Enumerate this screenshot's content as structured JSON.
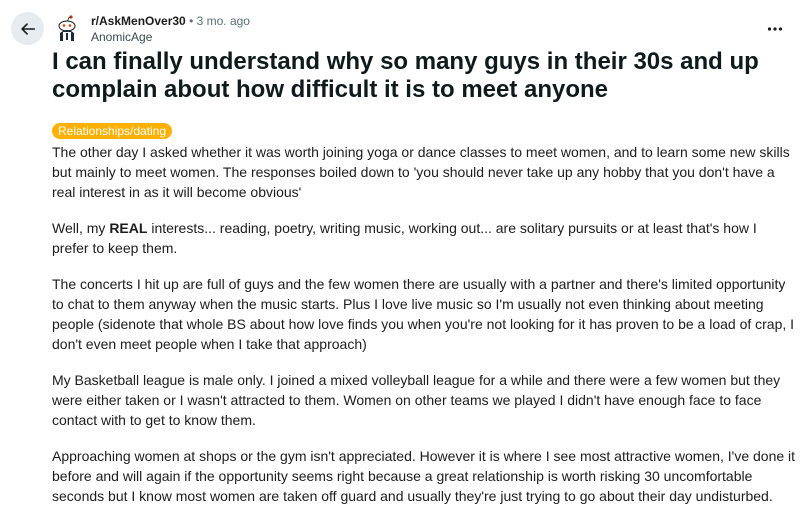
{
  "header": {
    "subreddit": "r/AskMenOver30",
    "separator": "•",
    "age": "3 mo. ago",
    "author": "AnomicAge",
    "icons": {
      "back": "arrow-left-icon",
      "more": "more-horizontal-icon",
      "avatar": "snoo-avatar-icon"
    }
  },
  "post": {
    "title": "I can finally understand why so many guys in their 30s and up complain about how difficult it is to meet anyone",
    "flair": "Relationships/dating",
    "flair_color": "#ffb000",
    "p1": "The other day I asked whether it was worth joining yoga or dance classes to meet women, and to learn some new skills but mainly to meet women. The responses boiled down to 'you should never take up any hobby that you don't have a real interest in as it will become obvious'",
    "p2_before": "Well, my ",
    "p2_bold": "REAL",
    "p2_after": " interests... reading, poetry, writing music, working out... are solitary pursuits or at least that's how I prefer to keep them.",
    "p3": "The concerts I hit up are full of guys and the few women there are usually with a partner and there's limited opportunity to chat to them anyway when the music starts. Plus I love live music so I'm usually not even thinking about meeting people (sidenote that whole BS about how love finds you when you're not looking for it has proven to be a load of crap, I don't even meet people when I take that approach)",
    "p4": "My Basketball league is male only. I joined a mixed volleyball league for a while and there were a few women but they were either taken or I wasn't attracted to them. Women on other teams we played I didn't have enough face to face contact with to get to know them.",
    "p5": "Approaching women at shops or the gym isn't appreciated. However it is where I see most attractive women, I've done it before and will again if the opportunity seems right because a great relationship is worth risking 30 uncomfortable seconds but I know most women are taken off guard and usually they're just trying to go about their day undisturbed."
  }
}
